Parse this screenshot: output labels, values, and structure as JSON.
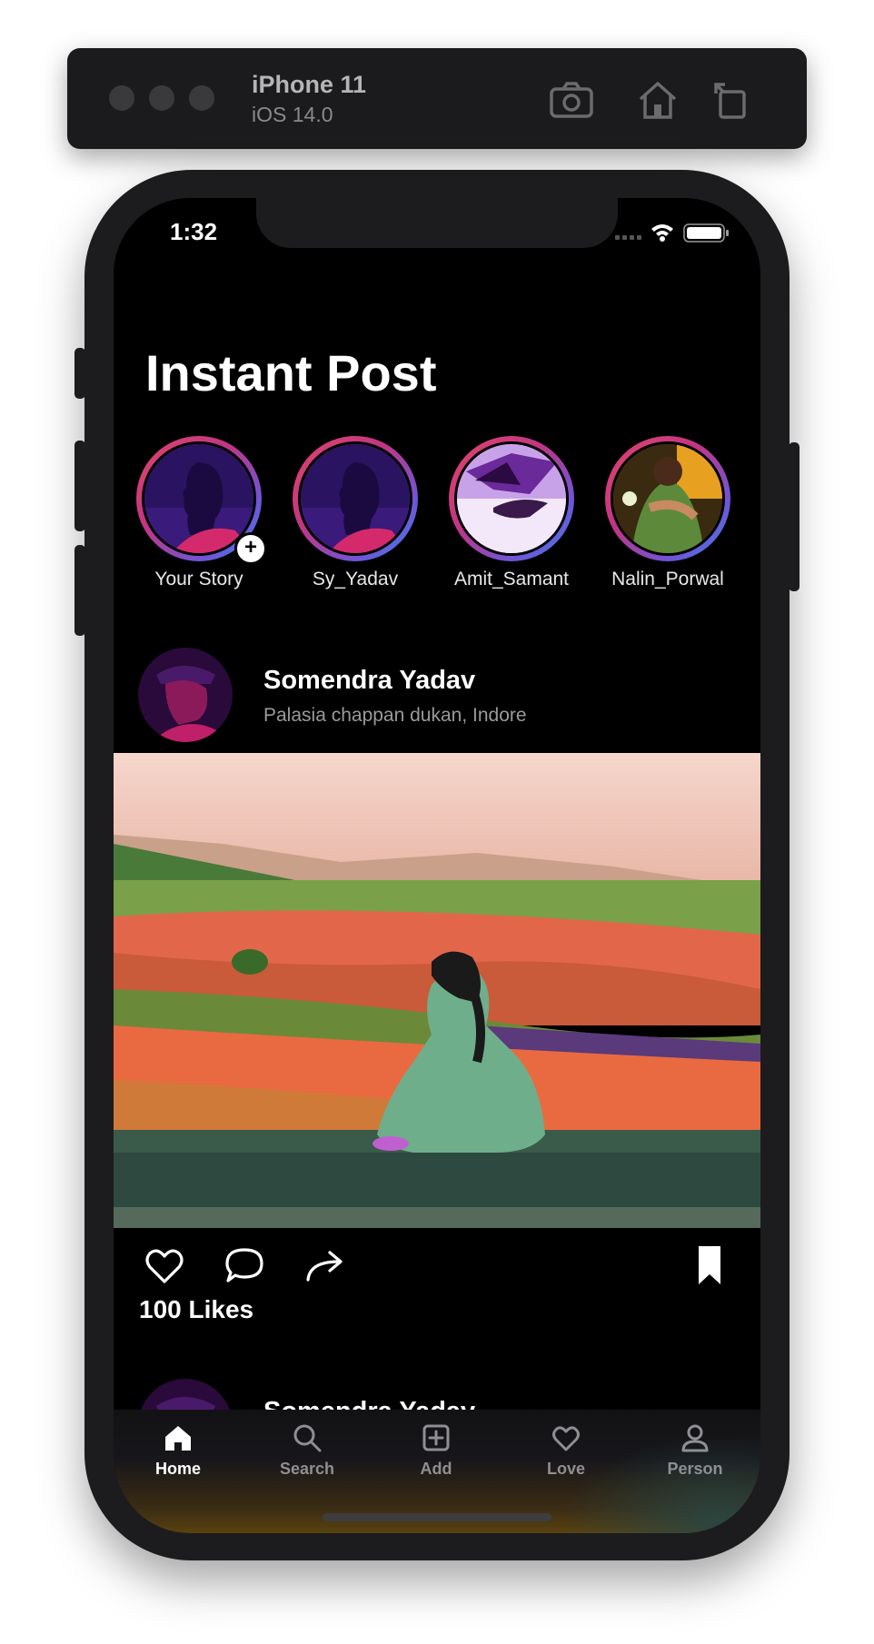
{
  "simulator": {
    "device_name": "iPhone 11",
    "os_version": "iOS 14.0",
    "icons": [
      "screenshot-icon",
      "home-icon",
      "rotate-icon"
    ]
  },
  "status_bar": {
    "time": "1:32",
    "icons": [
      "cellular-icon",
      "wifi-icon",
      "battery-icon"
    ]
  },
  "app": {
    "title": "Instant Post"
  },
  "stories": [
    {
      "label": "Your Story",
      "has_add_badge": true
    },
    {
      "label": "Sy_Yadav"
    },
    {
      "label": "Amit_Samant"
    },
    {
      "label": "Nalin_Porwal"
    }
  ],
  "story_add_badge": "+",
  "post": {
    "username": "Somendra Yadav",
    "location": "Palasia chappan dukan, Indore",
    "likes": "100 Likes",
    "actions": [
      "heart-icon",
      "comment-icon",
      "share-icon",
      "bookmark-icon"
    ]
  },
  "next_post": {
    "username": "Somendra Yadav"
  },
  "tabbar": {
    "tabs": [
      {
        "label": "Home",
        "icon": "home-icon",
        "active": true
      },
      {
        "label": "Search",
        "icon": "search-icon",
        "active": false
      },
      {
        "label": "Add",
        "icon": "add-icon",
        "active": false
      },
      {
        "label": "Love",
        "icon": "heart-icon",
        "active": false
      },
      {
        "label": "Person",
        "icon": "person-icon",
        "active": false
      }
    ]
  },
  "colors": {
    "background": "#000000",
    "tab_active": "#ffffff",
    "tab_inactive": "#8e8e93",
    "story_ring_start": "#e0466a",
    "story_ring_end": "#3f7fe8"
  }
}
